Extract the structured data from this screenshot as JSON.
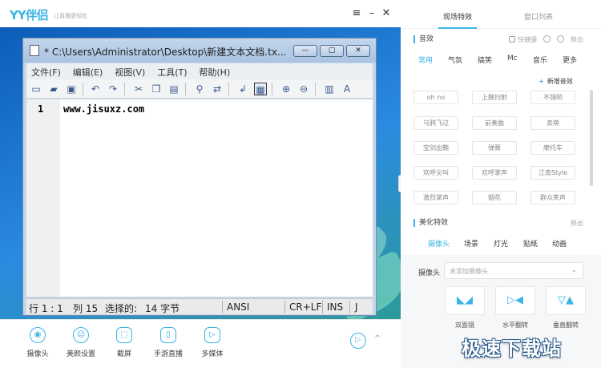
{
  "app": {
    "logo": "YY伴侣",
    "slogan": "让直播更轻松",
    "window_controls": {
      "menu": "≡",
      "minimize": "–",
      "close": "✕"
    }
  },
  "notepad": {
    "title": "* C:\\Users\\Administrator\\Desktop\\新建文本文档.tx...",
    "buttons": {
      "minimize": "—",
      "maximize": "▢",
      "close": "✕"
    },
    "menu": [
      "文件(F)",
      "编辑(E)",
      "视图(V)",
      "工具(T)",
      "帮助(H)"
    ],
    "toolbar_icons": [
      "new-icon",
      "open-icon",
      "save-icon",
      "undo-icon",
      "redo-icon",
      "cut-icon",
      "copy-icon",
      "paste-icon",
      "find-icon",
      "replace-icon",
      "wrap-icon",
      "view-icon",
      "zoom-in-icon",
      "zoom-out-icon",
      "scheme-icon",
      "font-icon"
    ],
    "line_number": "1",
    "content": "www.jisuxz.com",
    "status": {
      "position": "行 1 : 1",
      "column": "列 15",
      "selection": "选择的:",
      "bytes": "14 字节",
      "encoding": "ANSI",
      "eol": "CR+LF",
      "mode": "INS",
      "extra": "J"
    }
  },
  "bottom_bar": {
    "buttons": [
      {
        "label": "摄像头",
        "icon": "camera-icon"
      },
      {
        "label": "美颜设置",
        "icon": "beauty-icon"
      },
      {
        "label": "截屏",
        "icon": "screenshot-icon"
      },
      {
        "label": "手游直播",
        "icon": "mobile-live-icon"
      },
      {
        "label": "多媒体",
        "icon": "media-icon"
      }
    ],
    "expand_arrow": "^"
  },
  "right_panel": {
    "tabs": [
      "现场特效",
      "窗口列表"
    ],
    "active_tab": "现场特效",
    "sound_section": {
      "title": "音效",
      "shortcut_label": "快捷键",
      "remove_label": "移出",
      "categories": [
        "常用",
        "气氛",
        "搞笑",
        "Mc",
        "音乐",
        "更多"
      ],
      "active_category": "常用",
      "add_label": "新增音效",
      "add_symbol": "+",
      "items": [
        "oh no",
        "上膛扫射",
        "不错哟",
        "乌鸦飞过",
        "前奏曲",
        "卖萌",
        "宝剑出鞘",
        "弹簧",
        "摩托车",
        "欢呼尖叫",
        "欢呼掌声",
        "江南Style",
        "激烈掌声",
        "烟花",
        "群众笑声"
      ]
    },
    "beauty_section": {
      "title": "美化特效",
      "remove_label": "移出",
      "subtabs": [
        "摄像头",
        "场景",
        "灯光",
        "贴纸",
        "动画"
      ],
      "active_subtab": "摄像头",
      "camera_label": "摄像头",
      "camera_placeholder": "未添加摄像头",
      "flips": [
        "双面镜",
        "水平翻转",
        "垂直翻转"
      ]
    },
    "collapse_arrow": "‹",
    "accent_color": "#3ab5e6"
  },
  "watermark": "极速下载站"
}
